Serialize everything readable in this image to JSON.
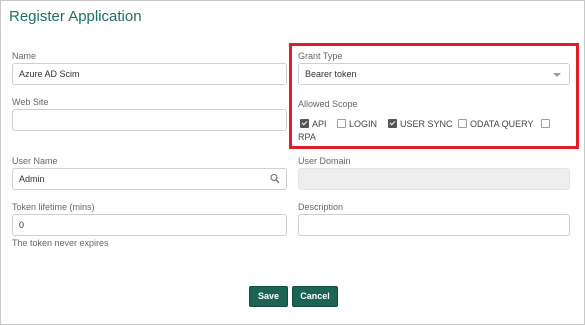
{
  "title": "Register Application",
  "fields": {
    "name": {
      "label": "Name",
      "value": "Azure AD Scim"
    },
    "website": {
      "label": "Web Site",
      "value": ""
    },
    "username": {
      "label": "User Name",
      "value": "Admin"
    },
    "token": {
      "label": "Token lifetime (mins)",
      "value": "0",
      "note": "The token never expires"
    },
    "grant": {
      "label": "Grant Type",
      "value": "Bearer token"
    },
    "domain": {
      "label": "User Domain",
      "value": ""
    },
    "description": {
      "label": "Description",
      "value": ""
    }
  },
  "scope": {
    "label": "Allowed Scope",
    "items": [
      {
        "label": "API",
        "checked": true
      },
      {
        "label": "LOGIN",
        "checked": false
      },
      {
        "label": "USER SYNC",
        "checked": true
      },
      {
        "label": "ODATA QUERY",
        "checked": false
      },
      {
        "label": "RPA",
        "checked": false
      }
    ]
  },
  "buttons": {
    "save": "Save",
    "cancel": "Cancel"
  },
  "colors": {
    "accent": "#1b6353",
    "title": "#1f6f63",
    "highlight": "#e01e2b"
  },
  "icons": {
    "search": "search-icon",
    "dropdown": "chevron-down-icon"
  }
}
